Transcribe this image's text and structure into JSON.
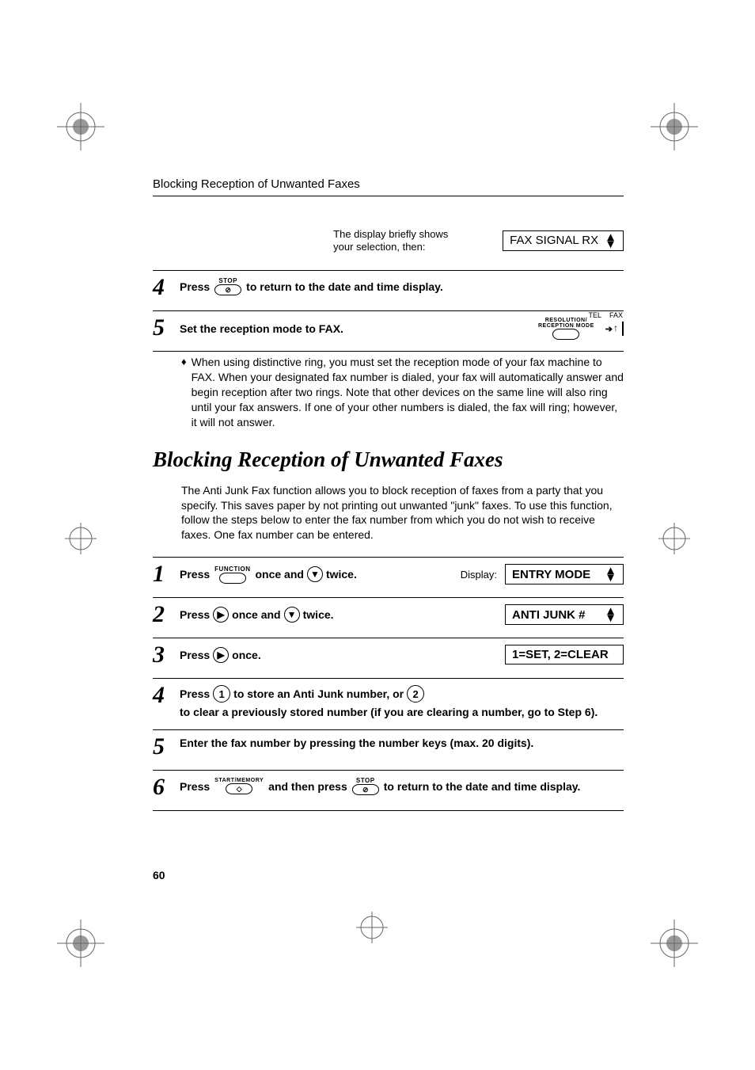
{
  "header": {
    "running_title": "Blocking Reception of Unwanted Faxes"
  },
  "top_display": {
    "label_line1": "The display briefly shows",
    "label_line2": "your selection, then:",
    "box_text": "FAX SIGNAL RX"
  },
  "prev_steps": {
    "s4": {
      "press": "Press",
      "stop_label": "STOP",
      "rest": "to return to the date and time display."
    },
    "s5": {
      "text": "Set the reception mode to FAX.",
      "resolution_label": "RESOLUTION/",
      "reception_label": "RECEPTION MODE",
      "tel": "TEL",
      "fax": "FAX"
    },
    "bullet": "When using distinctive ring, you must set the reception mode of your fax machine to FAX. When your designated fax number is dialed, your fax will automatically answer and begin reception after two rings. Note that other devices on the same line will also ring until your fax answers. If one of your other numbers is dialed, the fax will ring; however, it will not answer."
  },
  "section": {
    "title": "Blocking Reception of Unwanted Faxes",
    "intro": "The Anti Junk Fax function allows you to block reception of faxes from a party that you specify. This saves paper by not printing out unwanted \"junk\" faxes. To use this function, follow the steps below to enter the fax number from which you do not wish to receive faxes. One fax number can be entered."
  },
  "steps": {
    "s1": {
      "press": "Press",
      "function_label": "FUNCTION",
      "once_and": "once and",
      "twice": "twice.",
      "display_word": "Display:",
      "box": "ENTRY MODE"
    },
    "s2": {
      "press": "Press",
      "once_and": "once and",
      "twice": "twice.",
      "box": "ANTI JUNK #"
    },
    "s3": {
      "press": "Press",
      "once": "once.",
      "box": "1=SET, 2=CLEAR"
    },
    "s4": {
      "press": "Press",
      "mid": "to store an Anti Junk number, or",
      "end": "to clear a previously stored number (if you are clearing a number, go to Step 6).",
      "key1": "1",
      "key2": "2"
    },
    "s5": {
      "text": "Enter the fax number by pressing the number keys (max. 20 digits)."
    },
    "s6": {
      "press": "Press",
      "start_label": "START/MEMORY",
      "and_then": "and then press",
      "stop_label": "STOP",
      "rest": "to return to the date and time display."
    }
  },
  "page_number": "60"
}
